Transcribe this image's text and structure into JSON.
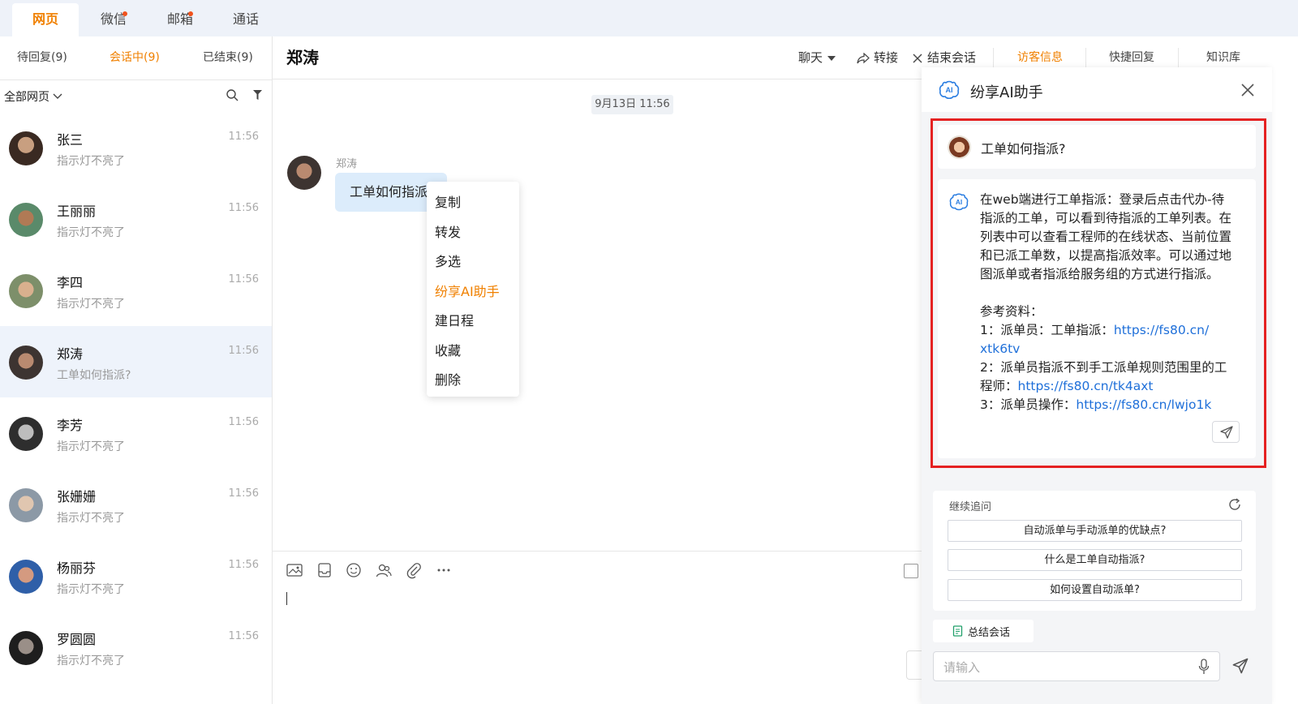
{
  "top_tabs": [
    {
      "label": "网页",
      "active": true
    },
    {
      "label": "微信",
      "badge": true
    },
    {
      "label": "邮箱",
      "badge": true
    },
    {
      "label": "通话"
    }
  ],
  "sidebar": {
    "subtabs": [
      "待回复(9)",
      "会话中(9)",
      "已结束(9)"
    ],
    "filter_label": "全部网页",
    "contacts": [
      {
        "name": "张三",
        "message": "指示灯不亮了",
        "time": "11:56"
      },
      {
        "name": "王丽丽",
        "message": "指示灯不亮了",
        "time": "11:56"
      },
      {
        "name": "李四",
        "message": "指示灯不亮了",
        "time": "11:56"
      },
      {
        "name": "郑涛",
        "message": "工单如何指派?",
        "time": "11:56",
        "selected": true
      },
      {
        "name": "李芳",
        "message": "指示灯不亮了",
        "time": "11:56"
      },
      {
        "name": "张姗姗",
        "message": "指示灯不亮了",
        "time": "11:56"
      },
      {
        "name": "杨丽芬",
        "message": "指示灯不亮了",
        "time": "11:56"
      },
      {
        "name": "罗圆圆",
        "message": "指示灯不亮了",
        "time": "11:56"
      }
    ]
  },
  "header": {
    "title": "郑涛",
    "chat_dropdown": "聊天",
    "transfer": "转接",
    "end_session": "结束会话",
    "right_tabs": [
      "访客信息",
      "快捷回复",
      "知识库"
    ]
  },
  "chat": {
    "date": "9月13日  11:56",
    "sender": "郑涛",
    "message": "工单如何指派?",
    "context_menu": [
      "复制",
      "转发",
      "多选",
      "纷享AI助手",
      "建日程",
      "收藏",
      "删除"
    ],
    "context_menu_active_index": 3
  },
  "ai_panel": {
    "title": "纷享AI助手",
    "question": "工单如何指派?",
    "answer_lines": [
      "在web端进行工单指派：登录后点击代办-待",
      "指派的工单，可以看到待指派的工单列表。在",
      "列表中可以查看工程师的在线状态、当前位置",
      "和已派工单数，以提高指派效率。可以通过地",
      "图派单或者指派给服务组的方式进行指派。"
    ],
    "references_title": "参考资料：",
    "references": [
      {
        "prefix": "1：派单员：工单指派：",
        "url_1": "https://fs80.cn/",
        "url_2": "xtk6tv"
      },
      {
        "prefix_1": "2：派单员指派不到手工派单规则范围里的工",
        "prefix_2": "程师：",
        "url": "https://fs80.cn/tk4axt"
      },
      {
        "prefix": "3：派单员操作：",
        "url": "https://fs80.cn/lwjo1k"
      }
    ],
    "followup_title": "继续追问",
    "suggestions": [
      "自动派单与手动派单的优缺点?",
      "什么是工单自动指派?",
      "如何设置自动派单?"
    ],
    "summarize_label": "总结会话",
    "input_placeholder": "请输入"
  },
  "colors": {
    "accent": "#f08000",
    "highlight_border": "#e52222",
    "link": "#1e6fd9"
  }
}
